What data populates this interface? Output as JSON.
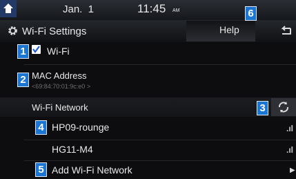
{
  "status": {
    "date": "Jan.  1",
    "time": "11:45",
    "ampm": "AM"
  },
  "header": {
    "title": "Wi-Fi Settings",
    "help_label": "Help"
  },
  "wifi_toggle": {
    "label": "Wi-Fi",
    "checked": true
  },
  "mac": {
    "label": "MAC Address",
    "value": "<69:84:70:01:9c:e0 >"
  },
  "network_section": {
    "label": "Wi-Fi Network"
  },
  "networks": [
    {
      "name": "HP09-rounge"
    },
    {
      "name": "HG11-M4"
    }
  ],
  "add_network": {
    "label": "Add Wi-Fi Network"
  },
  "callouts": [
    "1",
    "2",
    "3",
    "4",
    "5",
    "6"
  ],
  "icons": [
    "home-icon",
    "gear-icon",
    "back-icon",
    "check-icon",
    "refresh-icon",
    "signal-icon",
    "arrow-right-icon"
  ],
  "colors": {
    "callout_blue": "#1a76d2",
    "background": "#0d0d0f"
  }
}
